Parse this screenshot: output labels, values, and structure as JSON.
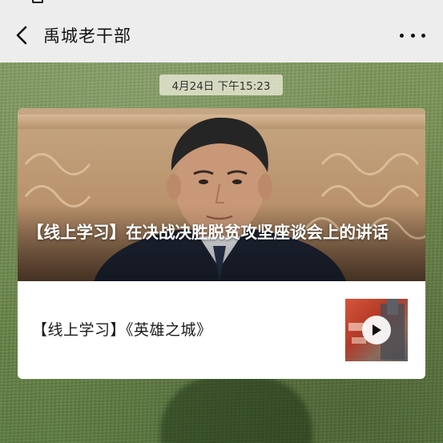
{
  "nav": {
    "title": "禹城老干部"
  },
  "chat": {
    "timestamp": "4月24日 下午15:23"
  },
  "article": {
    "cover_title": "【线上学习】在决战决胜脱贫攻坚座谈会上的讲话",
    "second_title": "【线上学习】《英雄之城》"
  },
  "icons": {
    "back": "chevron-left-icon",
    "more": "more-dots-icon",
    "play": "play-icon"
  },
  "colors": {
    "nav_bg": "#ededed",
    "card_bg": "#ffffff",
    "chip_bg": "#e6e6d2"
  }
}
